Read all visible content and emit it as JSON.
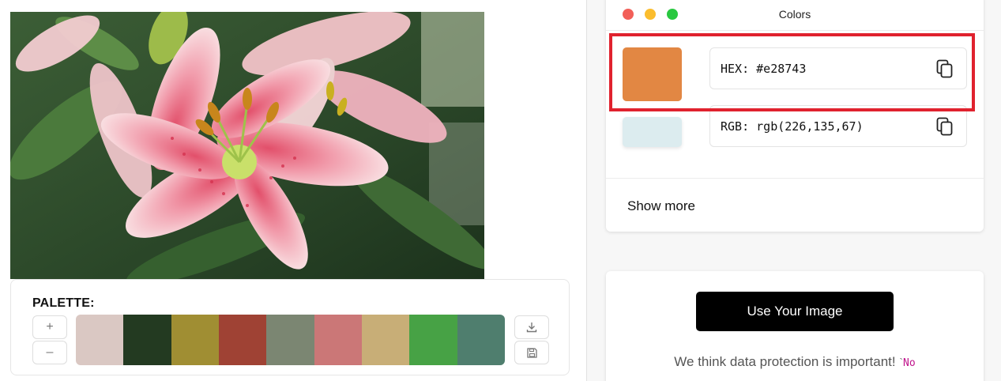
{
  "left": {
    "image": {
      "alt": "pink and white stargazer lilies"
    },
    "palette": {
      "title": "PALETTE:",
      "add_icon": "plus-icon",
      "remove_icon": "minus-icon",
      "download_icon": "download-icon",
      "save_icon": "save-icon",
      "add_symbol": "+",
      "remove_symbol": "–",
      "swatches": [
        "#dac8c3",
        "#233a21",
        "#a08e33",
        "#9f4234",
        "#7b8672",
        "#cb7777",
        "#c8ae77",
        "#47a245",
        "#4f7e6e"
      ]
    }
  },
  "right": {
    "window": {
      "title": "Colors"
    },
    "selected_color": "#e28743",
    "secondary_color": "#dcecef",
    "hex_row": {
      "text": "HEX: #e28743",
      "copy_icon": "copy-icon"
    },
    "rgb_row": {
      "text": "RGB: rgb(226,135,67)",
      "copy_icon": "copy-icon"
    },
    "show_more_label": "Show more",
    "upload": {
      "button_label": "Use Your Image",
      "privacy_text": "We think data protection is important! ",
      "privacy_tick": "`",
      "privacy_code": "No"
    }
  },
  "colors": {
    "highlight": "#e0222e",
    "button_bg": "#000000"
  }
}
